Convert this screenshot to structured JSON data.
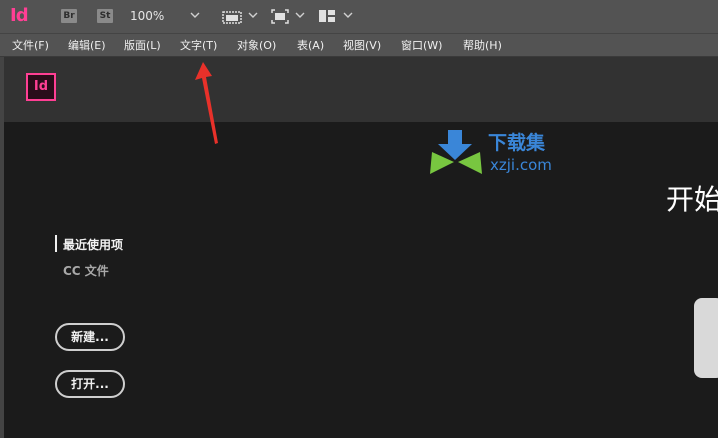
{
  "app": {
    "logo_text": "Id",
    "bridge_badge": "Br",
    "stock_badge": "St",
    "zoom": "100%",
    "accent_color": "#ff3f94"
  },
  "menu": {
    "items": [
      {
        "label": "文件(F)"
      },
      {
        "label": "编辑(E)"
      },
      {
        "label": "版面(L)"
      },
      {
        "label": "文字(T)"
      },
      {
        "label": "对象(O)"
      },
      {
        "label": "表(A)"
      },
      {
        "label": "视图(V)"
      },
      {
        "label": "窗口(W)"
      },
      {
        "label": "帮助(H)"
      }
    ]
  },
  "start": {
    "logo_text": "Id",
    "title": "开始",
    "recent_label": "最近使用项",
    "cc_files_label": "CC 文件",
    "new_button": "新建...",
    "open_button": "打开..."
  },
  "watermark": {
    "title": "下载集",
    "subtitle": "xzji.com"
  },
  "icons": [
    "screen-mode-icon",
    "view-options-icon",
    "arrange-documents-icon",
    "chevron-down-icon"
  ]
}
